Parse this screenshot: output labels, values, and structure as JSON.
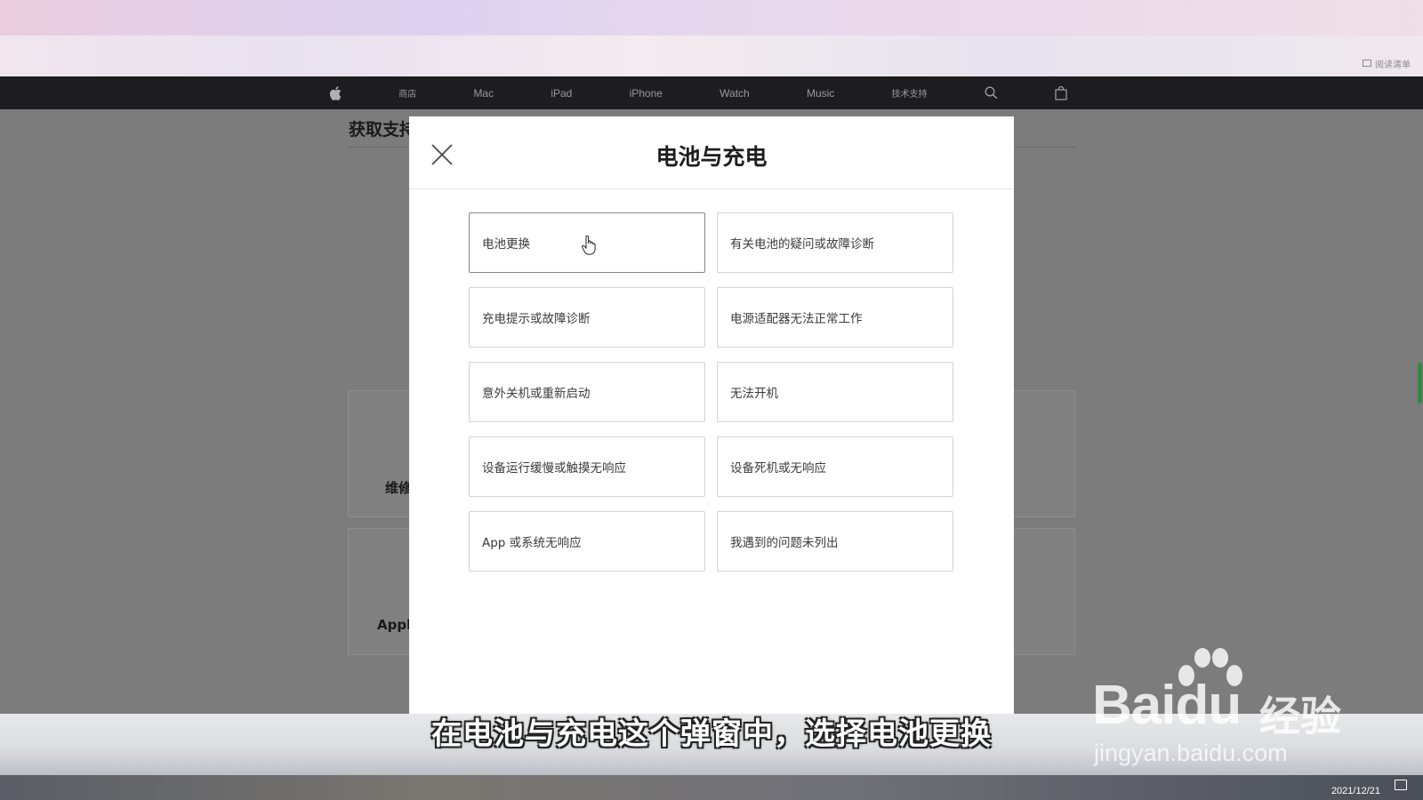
{
  "browser": {
    "reading_list_label": "阅读清单"
  },
  "nav": {
    "items": [
      "商店",
      "Mac",
      "iPad",
      "iPhone",
      "Watch",
      "Music",
      "技术支持"
    ],
    "icons": [
      "apple-logo",
      "search-icon",
      "bag-icon"
    ]
  },
  "page": {
    "title": "获取支持",
    "card_labels": [
      "维修",
      "Apple"
    ]
  },
  "modal": {
    "title": "电池与充电",
    "options": [
      "电池更换",
      "有关电池的疑问或故障诊断",
      "充电提示或故障诊断",
      "电源适配器无法正常工作",
      "意外关机或重新启动",
      "无法开机",
      "设备运行缓慢或触摸无响应",
      "设备死机或无响应",
      "App 或系统无响应",
      "我遇到的问题未列出"
    ],
    "hovered_option": "电池更换"
  },
  "subtitle": "在电池与充电这个弹窗中，选择电池更换",
  "watermark": {
    "brand": "Bai",
    "brand2": "du",
    "cn": "经验",
    "url": "jingyan.baidu.com"
  },
  "taskbar": {
    "date": "2021/12/21"
  },
  "colors": {
    "nav_bg": "#1d1d1f",
    "modal_bg": "#ffffff",
    "overlay": "#7c7c7c",
    "option_border": "#d2d2d7"
  }
}
